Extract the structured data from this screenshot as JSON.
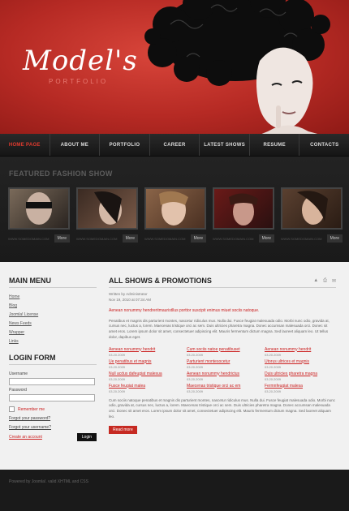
{
  "logo": {
    "title": "Model's",
    "subtitle": "PORTFOLIO"
  },
  "nav": [
    "HOME PAGE",
    "ABOUT ME",
    "PORTFOLIO",
    "CAREER",
    "LATEST SHOWS",
    "RESUME",
    "CONTACTS"
  ],
  "featured": {
    "title": "FEATURED FASHION SHOW",
    "thumbs": [
      {
        "url": "WWW.SOMEDOMAIN.COM",
        "more": "More"
      },
      {
        "url": "WWW.SOMEDOMAIN.COM",
        "more": "More"
      },
      {
        "url": "WWW.SOMEDOMAIN.COM",
        "more": "More"
      },
      {
        "url": "WWW.SOMEDOMAIN.COM",
        "more": "More"
      },
      {
        "url": "WWW.SOMEDOMAIN.COM",
        "more": "More"
      }
    ]
  },
  "sidebar": {
    "menu_title": "MAIN MENU",
    "menu": [
      "Home",
      "Blog",
      "Joomla! License",
      "News Feeds",
      "Wrapper",
      "Links"
    ],
    "login_title": "LOGIN FORM",
    "username_label": "Username",
    "password_label": "Password",
    "remember": "Remember me",
    "forgot_password": "Forgot your password?",
    "forgot_username": "Forgot your username?",
    "create": "Create an account",
    "login_btn": "Login"
  },
  "main": {
    "title": "ALL SHOWS & PROMOTIONS",
    "written": "Written by Administrator",
    "date": "Nov 19, 2010 at 07:34 AM",
    "lead": "Aenean nonummy hendreritmauristllus porttor suscipit enimus miuet sociis natoque.",
    "para1": "Penatibus et magnis dis parturient montes, nascetur ridiculus mus. Nulla dui. Fusce feugiat malesuada odio. Morbi nunc odio, gravida at, cursus nec, luctus a, lorem. Maecenas tristique orci ac sem. Duis ultricies pharetra magna. Donec accumsan malesuada orci. Donec sit amet eros. Lorem ipsum dolor sit amet, consectetuer adipiscing elit. Mauris fermentum dictum magna. Sed laoreet aliquam leo. Ut tellus dolor, dapibus eget.",
    "links": [
      {
        "t": "Aenean nonummy hendrit",
        "d": "03.20.2009"
      },
      {
        "t": "Cum sociis natoe penatibuset",
        "d": "03.20.2009"
      },
      {
        "t": "Aenean nonummy hendrit",
        "d": "03.20.2009"
      },
      {
        "t": "Ue penatibus et magnis",
        "d": "03.20.2009"
      },
      {
        "t": "Parturient montesocetur",
        "d": "03.20.2009"
      },
      {
        "t": "Utorus ultrices et magnis",
        "d": "03.20.2009"
      },
      {
        "t": "Null acdus dafeugiat malesua",
        "d": "03.20.2009"
      },
      {
        "t": "Aenean nonummy hendrictus",
        "d": "03.20.2009"
      },
      {
        "t": "Duis ultricies pharetra magna",
        "d": "03.20.2009"
      },
      {
        "t": "Fusce feugiat malea",
        "d": "03.20.2009"
      },
      {
        "t": "Maecenas tristique orci ac em",
        "d": "03.20.2009"
      },
      {
        "t": "Fermnfeugiat malesa",
        "d": "03.20.2009"
      }
    ],
    "para2": "Cum sociis natoque penatibus et magnis dis parturient montes, nascetur ridiculus mus. Nulla dui. Fusce feugiat malesuada odio. Morbi nunc odio, gravida at, cursus nec, luctus a, lorem. Maecenas tristique orci ac sem. Duis ultricies pharetra magna. Donec accumsan malesuada orci. Donec sit amet eros. Lorem ipsum dolor sit amet, consectetuer adipiscing elit. Mauris fermentum dictum magna. Sed laoreet aliquam leo.",
    "readmore": "Read more"
  },
  "footer": {
    "text": "Powered by Joomla!. valid XHTML and CSS"
  },
  "colors": {
    "accent": "#c62a22",
    "header_red": "#b62a24",
    "dark": "#1b1b1b"
  }
}
